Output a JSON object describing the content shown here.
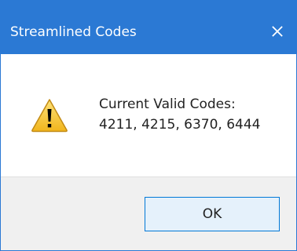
{
  "window": {
    "title": "Streamlined Codes",
    "close_glyph": "✕"
  },
  "message": {
    "line1": "Current Valid Codes:",
    "line2": "4211, 4215, 6370, 6444"
  },
  "icon": {
    "name": "warning-icon",
    "fill": "#f6c83a",
    "outline": "#c28a14",
    "mark": "#000000"
  },
  "buttons": {
    "ok_label": "OK"
  },
  "colors": {
    "titlebar": "#2b79d4",
    "footer": "#f0f0f0",
    "button_bg": "#e5f1fb",
    "button_border": "#0078d7"
  }
}
